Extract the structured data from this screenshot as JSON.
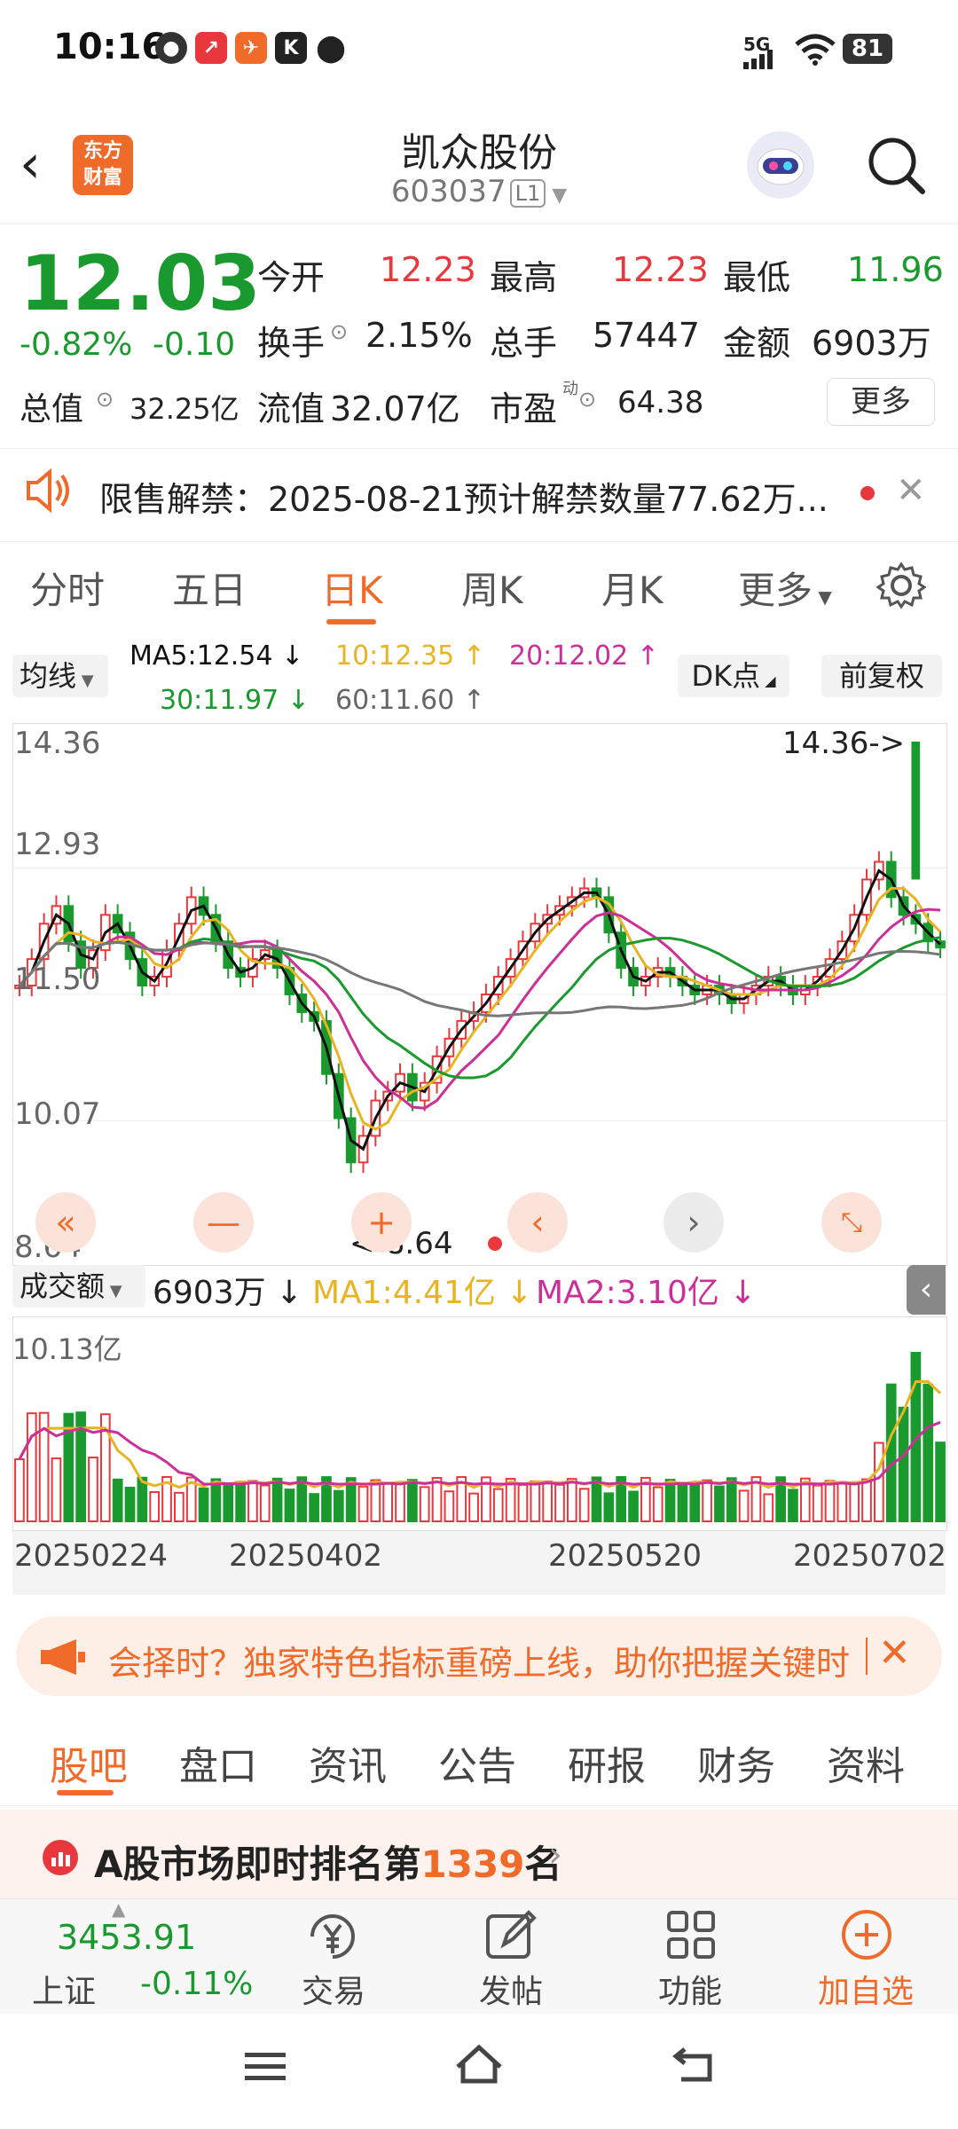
{
  "status": {
    "time": "10:16",
    "network": "5G",
    "battery": "81"
  },
  "header": {
    "title": "凯众股份",
    "code": "603037",
    "level": "L1",
    "logo_line1": "东方",
    "logo_line2": "财富"
  },
  "quote": {
    "price": "12.03",
    "change_pct": "-0.82%",
    "change": "-0.10",
    "open_label": "今开",
    "open": "12.23",
    "high_label": "最高",
    "high": "12.23",
    "low_label": "最低",
    "low": "11.96",
    "turnover_label": "换手",
    "turnover": "2.15%",
    "volume_label": "总手",
    "volume": "57447",
    "amount_label": "金额",
    "amount": "6903万",
    "mktcap_label": "总值",
    "mktcap": "32.25亿",
    "float_label": "流值",
    "float": "32.07亿",
    "pe_label": "市盈",
    "pe_sup": "动",
    "pe": "64.38",
    "more": "更多"
  },
  "notice": {
    "text": "限售解禁：2025-08-21预计解禁数量77.62万..."
  },
  "tabs": [
    "分时",
    "五日",
    "日K",
    "周K",
    "月K",
    "更多"
  ],
  "active_tab": "日K",
  "ma_bar": {
    "selector": "均线",
    "ma5": "MA5:12.54 ↓",
    "ma10": "10:12.35 ↑",
    "ma20": "20:12.02 ↑",
    "ma30": "30:11.97 ↓",
    "ma60": "60:11.60 ↑",
    "dk": "DK点",
    "adjust": "前复权"
  },
  "price_axis": [
    "14.36",
    "12.93",
    "11.50",
    "10.07",
    "8.64"
  ],
  "annot": {
    "high": "14.36->",
    "low": "<-8.64"
  },
  "volume_bar": {
    "selector": "成交额",
    "value": "6903万 ↓",
    "ma1": "MA1:4.41亿 ↓",
    "ma2": "MA2:3.10亿 ↓",
    "axis_top": "10.13亿"
  },
  "dates": [
    "20250224",
    "20250402",
    "20250520",
    "20250702"
  ],
  "banner": {
    "text": "会择时？独家特色指标重磅上线，助你把握关键时"
  },
  "bottom_tabs": [
    "股吧",
    "盘口",
    "资讯",
    "公告",
    "研报",
    "财务",
    "资料"
  ],
  "rank": {
    "prefix": "A股市场即时排名第",
    "num": "1339",
    "suffix": "名"
  },
  "nav": {
    "index_value": "3453.91",
    "index_name": "上证",
    "index_change": "-0.11%",
    "trade": "交易",
    "post": "发帖",
    "func": "功能",
    "add": "加自选"
  },
  "colors": {
    "up": "#e8383d",
    "down": "#1a9a2e",
    "accent": "#f06a2a",
    "ma5": "#111111",
    "ma10": "#e8b423",
    "ma20": "#cc2f98",
    "ma30": "#1a9a2e",
    "ma60": "#777777"
  }
}
